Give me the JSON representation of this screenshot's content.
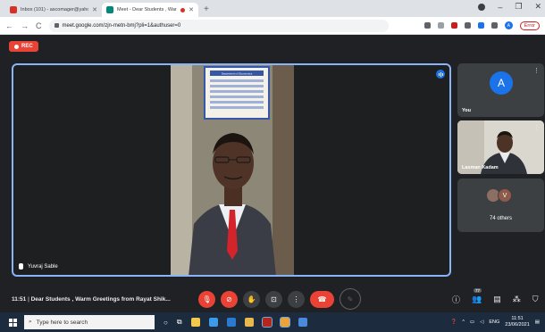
{
  "browser": {
    "tabs": [
      {
        "title": "Inbox (101) - ascomager@yahoo...",
        "favicon_color": "#d93025",
        "active": false
      },
      {
        "title": "Meet - Dear Students , War...",
        "favicon_color": "#00897b",
        "active": true
      }
    ],
    "new_tab": "+",
    "window_controls": {
      "minimize": "–",
      "maximize": "❐",
      "close": "✕"
    },
    "nav": {
      "back": "←",
      "forward": "→",
      "reload": "C"
    },
    "url": "meet.google.com/zjn-metn-bmj?pli=1&authuser=0",
    "error_label": "Error"
  },
  "meet": {
    "rec_label": "REC",
    "main_participant": "Yuvraj Sable",
    "self_tile": {
      "label": "You",
      "avatar_letter": "A"
    },
    "second_tile": {
      "label": "Laxman Kadam"
    },
    "others_tile": {
      "label": "74 others",
      "avatar_letter": "V"
    },
    "time": "11:51",
    "meeting_title": "Dear Students , Warm Greetings from Rayat Shik...",
    "participants_badge": "77",
    "poster_title": "Department of Economics"
  },
  "taskbar": {
    "search_placeholder": "Type here to search",
    "tray_lang": "ENG",
    "clock_time": "11:51",
    "clock_date": "23/06/2021"
  }
}
